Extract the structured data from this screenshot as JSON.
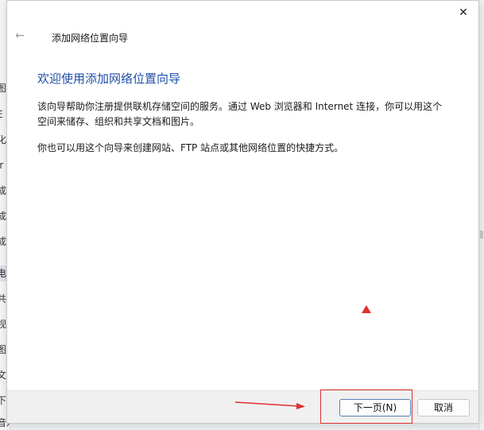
{
  "background_window": {
    "items": [
      "图",
      "E",
      "化",
      "ir",
      "成",
      "成",
      "成",
      "电",
      "共",
      "视",
      "图",
      "文",
      "下",
      "音乐"
    ]
  },
  "dialog": {
    "title": "添加网络位置向导",
    "heading": "欢迎使用添加网络位置向导",
    "paragraph1": "该向导帮助你注册提供联机存储空间的服务。通过 Web 浏览器和 Internet 连接，你可以用这个空间来储存、组织和共享文档和图片。",
    "paragraph2": "你也可以用这个向导来创建网站、FTP 站点或其他网络位置的快捷方式。",
    "buttons": {
      "next": "下一页(N)",
      "cancel": "取消"
    },
    "close_glyph": "✕",
    "back_glyph": "←"
  },
  "colors": {
    "heading": "#1f4fa8",
    "annotation": "#e03030",
    "default_button_border": "#5a7fb0"
  },
  "icons": [
    "close-icon",
    "back-arrow-icon",
    "annotation-arrow-icon",
    "annotation-triangle-icon"
  ]
}
